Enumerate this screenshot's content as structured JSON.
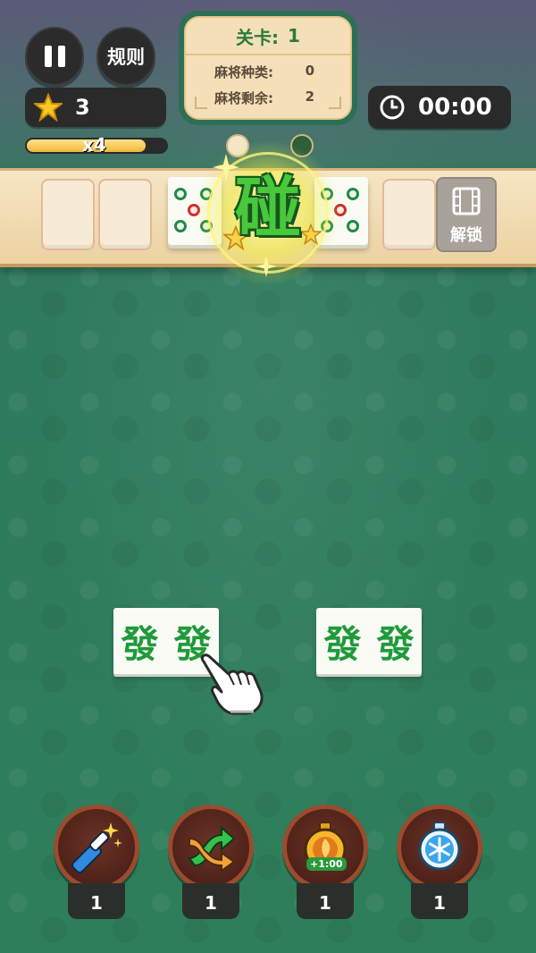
{
  "hud": {
    "rules_label": "规则",
    "stars": "3",
    "multiplier": "x4",
    "multiplier_progress": 0.85,
    "timer": "00:00"
  },
  "level_card": {
    "title": "关卡:",
    "level": "1",
    "types_label": "麻将种类:",
    "types_value": "0",
    "remaining_label": "麻将剩余:",
    "remaining_value": "2"
  },
  "tray": {
    "pong_text": "碰",
    "unlock_label": "解锁"
  },
  "board": {
    "tile_char": "發"
  },
  "tools": [
    {
      "name": "magic-wand-icon",
      "count": "1"
    },
    {
      "name": "shuffle-icon",
      "count": "1"
    },
    {
      "name": "add-time-icon",
      "count": "1",
      "badge": "+1:00"
    },
    {
      "name": "freeze-icon",
      "count": "1"
    }
  ],
  "colors": {
    "accent_green": "#48c83a",
    "tile_green": "#1f9a3b",
    "card_bg": "#f4dfb8"
  }
}
